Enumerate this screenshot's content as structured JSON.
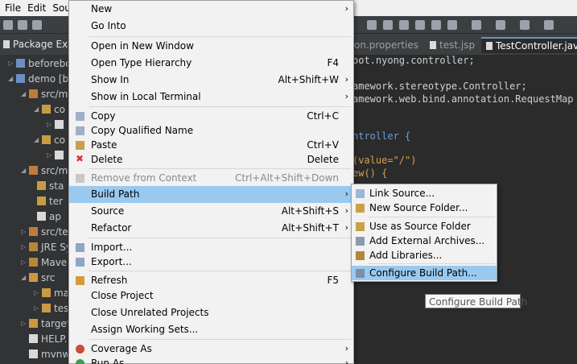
{
  "menubar": {
    "items": [
      "File",
      "Edit",
      "Sou"
    ]
  },
  "package_explorer": {
    "tab_label": "Package Exp",
    "items": [
      {
        "label": "beforebo",
        "icon": "project-icon"
      },
      {
        "label": "demo [b",
        "icon": "project-icon"
      },
      {
        "label": "src/m",
        "icon": "source-folder-icon"
      },
      {
        "label": "co",
        "icon": "package-icon"
      },
      {
        "label": "",
        "icon": "java-file-icon"
      },
      {
        "label": "co",
        "icon": "package-icon"
      },
      {
        "label": "",
        "icon": "java-file-icon"
      },
      {
        "label": "src/m",
        "icon": "source-folder-icon"
      },
      {
        "label": "sta",
        "icon": "folder-icon"
      },
      {
        "label": "ter",
        "icon": "folder-icon"
      },
      {
        "label": "ap",
        "icon": "file-icon"
      },
      {
        "label": "src/te",
        "icon": "source-folder-icon"
      },
      {
        "label": "JRE Sy",
        "icon": "library-icon"
      },
      {
        "label": "Mave",
        "icon": "library-icon"
      },
      {
        "label": "src",
        "icon": "folder-icon"
      },
      {
        "label": "ma",
        "icon": "folder-icon"
      },
      {
        "label": "tes",
        "icon": "folder-icon"
      },
      {
        "label": "target",
        "icon": "folder-icon"
      },
      {
        "label": "HELP.",
        "icon": "file-icon"
      },
      {
        "label": "mvnw",
        "icon": "file-icon"
      }
    ]
  },
  "editor": {
    "tabs": [
      {
        "label": "on.properties"
      },
      {
        "label": "test.jsp"
      },
      {
        "label": "TestController.java"
      }
    ],
    "code_lines": [
      "oot.nyong.controller;",
      "amework.stereotype.Controller;",
      "amework.web.bind.annotation.RequestMap",
      "ntroller {",
      "(value=\"/\")",
      "ew() {"
    ]
  },
  "context_menu": {
    "items": [
      {
        "label": "New",
        "accel": "",
        "submenu": true
      },
      {
        "label": "Go Into",
        "accel": ""
      },
      {
        "label": "Open in New Window",
        "accel": ""
      },
      {
        "label": "Open Type Hierarchy",
        "accel": "F4"
      },
      {
        "label": "Show In",
        "accel": "Alt+Shift+W",
        "submenu": true
      },
      {
        "label": "Show in Local Terminal",
        "accel": "",
        "submenu": true
      },
      {
        "label": "Copy",
        "accel": "Ctrl+C",
        "icon": "copy-icon"
      },
      {
        "label": "Copy Qualified Name",
        "accel": "",
        "icon": "copy-qualified-icon"
      },
      {
        "label": "Paste",
        "accel": "Ctrl+V",
        "icon": "paste-icon"
      },
      {
        "label": "Delete",
        "accel": "Delete",
        "icon": "delete-icon"
      },
      {
        "label": "Remove from Context",
        "accel": "Ctrl+Alt+Shift+Down",
        "disabled": true
      },
      {
        "label": "Build Path",
        "accel": "",
        "submenu": true,
        "highlighted": true
      },
      {
        "label": "Source",
        "accel": "Alt+Shift+S",
        "submenu": true
      },
      {
        "label": "Refactor",
        "accel": "Alt+Shift+T",
        "submenu": true
      },
      {
        "label": "Import...",
        "accel": "",
        "icon": "import-icon"
      },
      {
        "label": "Export...",
        "accel": "",
        "icon": "export-icon"
      },
      {
        "label": "Refresh",
        "accel": "F5",
        "icon": "refresh-icon"
      },
      {
        "label": "Close Project",
        "accel": ""
      },
      {
        "label": "Close Unrelated Projects",
        "accel": ""
      },
      {
        "label": "Assign Working Sets...",
        "accel": ""
      },
      {
        "label": "Coverage As",
        "accel": "",
        "submenu": true,
        "icon": "coverage-icon"
      },
      {
        "label": "Run As",
        "accel": "",
        "submenu": true,
        "icon": "run-icon"
      }
    ],
    "arrow": "›"
  },
  "build_path_submenu": {
    "items": [
      {
        "label": "Link Source...",
        "icon": "link-source-icon"
      },
      {
        "label": "New Source Folder...",
        "icon": "new-source-folder-icon"
      },
      {
        "label": "Use as Source Folder",
        "icon": "use-source-folder-icon"
      },
      {
        "label": "Add External Archives...",
        "icon": "external-archives-icon"
      },
      {
        "label": "Add Libraries...",
        "icon": "libraries-icon"
      },
      {
        "label": "Configure Build Path...",
        "icon": "configure-build-path-icon",
        "highlighted": true
      }
    ]
  },
  "tooltip": {
    "text": "Configure Build Path"
  },
  "colors": {
    "highlight": "#99c9ef",
    "menu_bg": "#f2f2f2",
    "editor_bg": "#2b2b2b"
  }
}
